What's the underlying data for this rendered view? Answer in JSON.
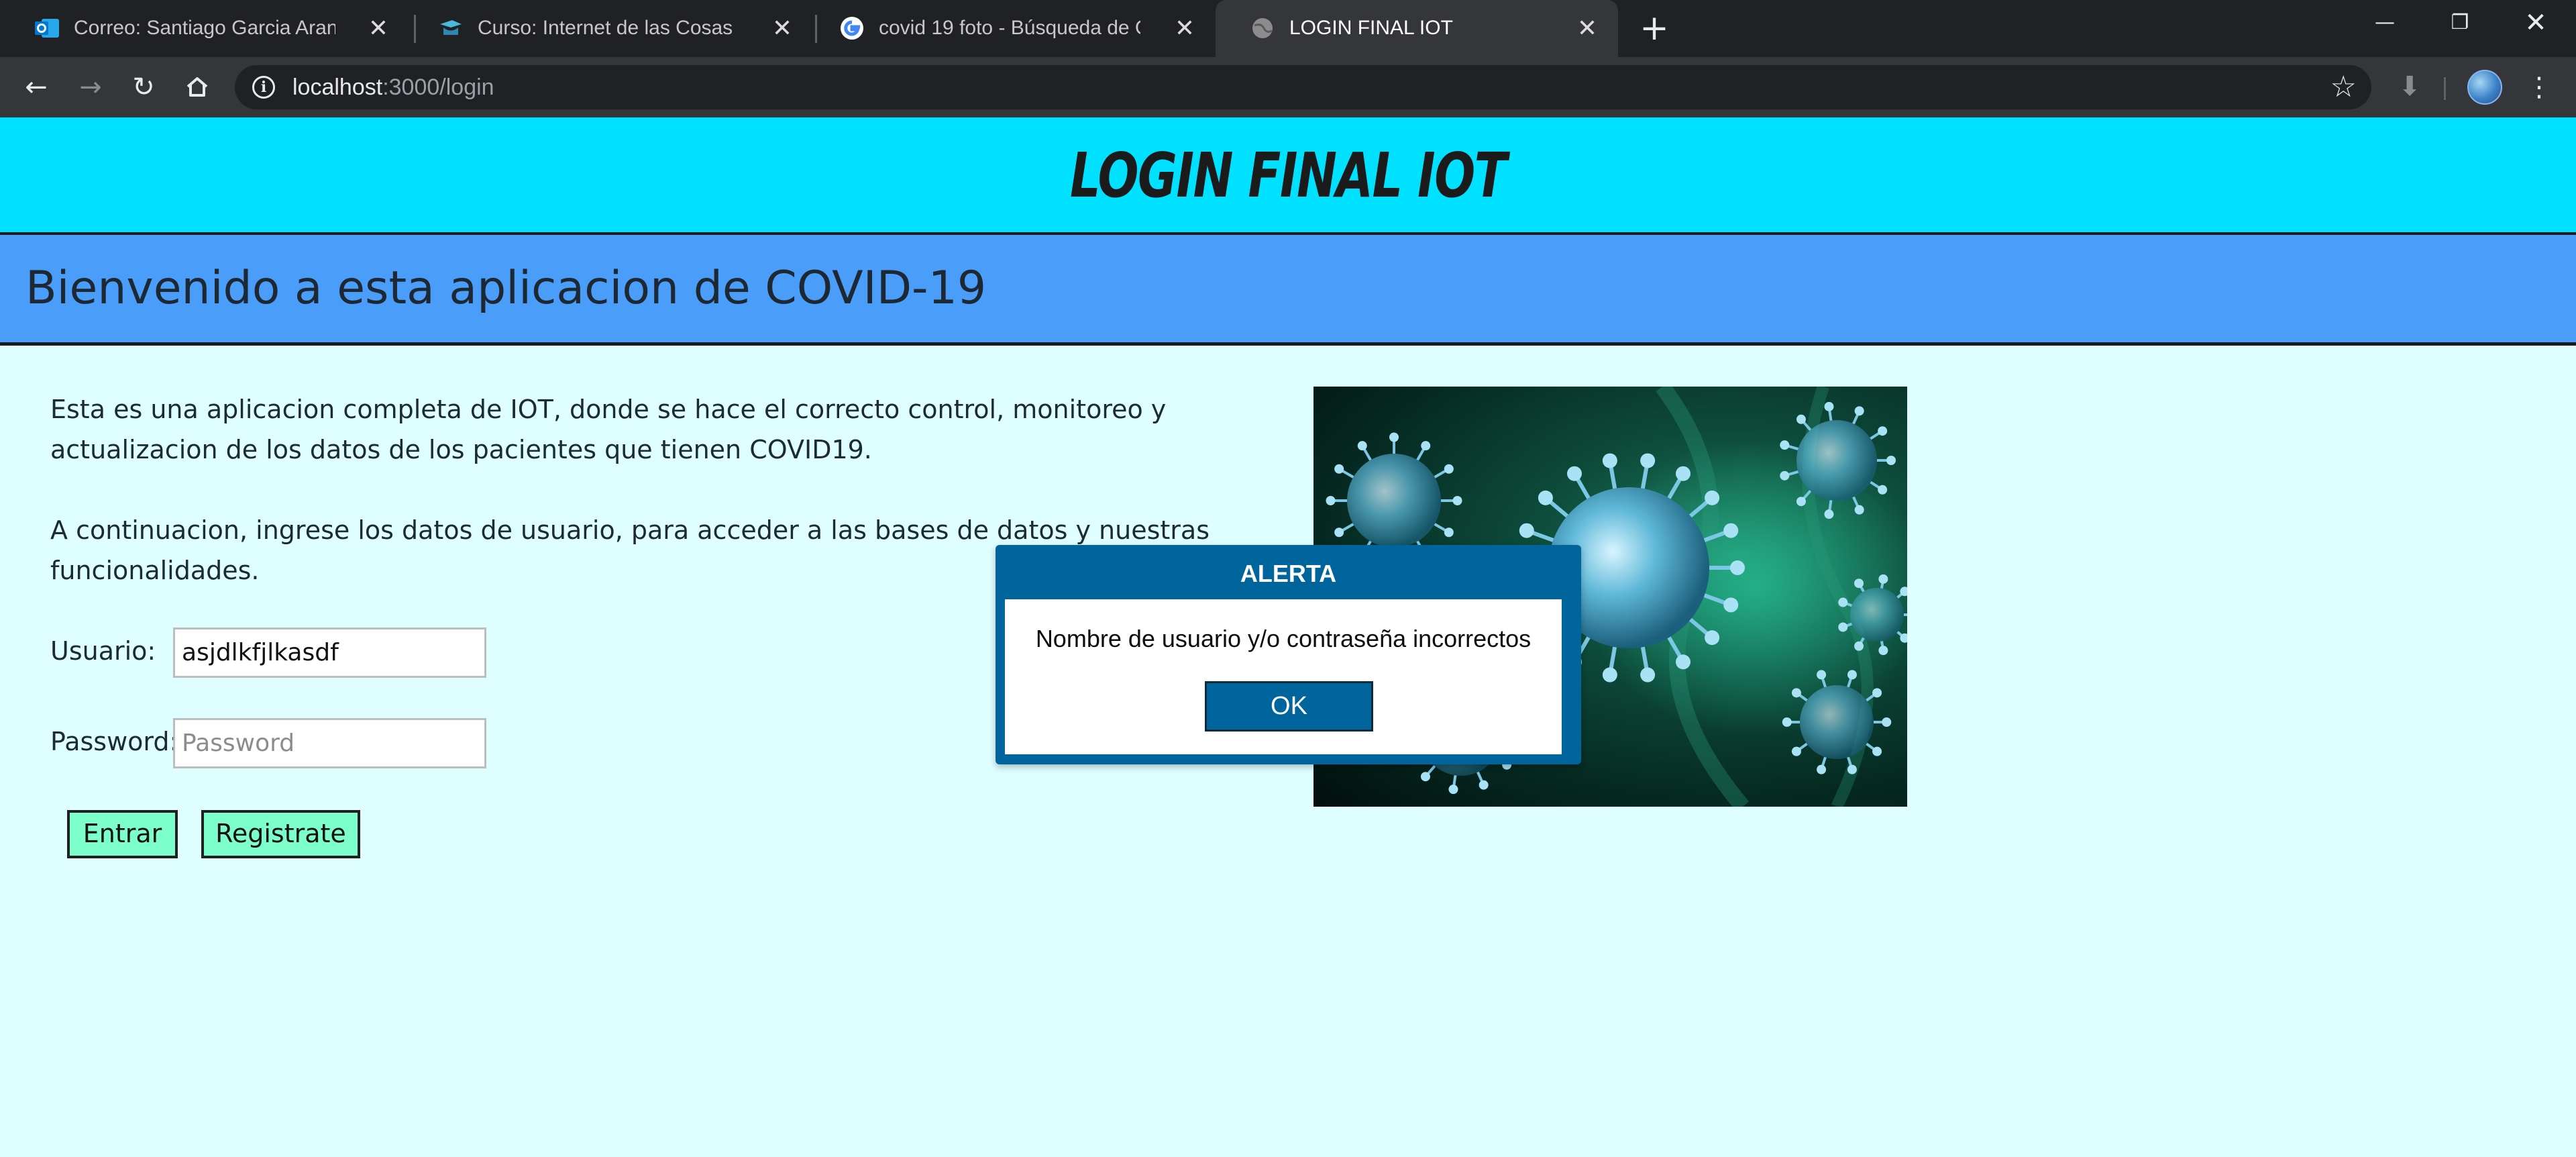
{
  "browser": {
    "tabs": [
      {
        "title": "Correo: Santiago Garcia Arango - ",
        "favicon": "outlook-icon",
        "active": false
      },
      {
        "title": "Curso: Internet de las Cosas",
        "favicon": "moodle-icon",
        "active": false
      },
      {
        "title": "covid 19 foto - Búsqueda de Goo",
        "favicon": "google-icon",
        "active": false
      },
      {
        "title": "LOGIN FINAL IOT",
        "favicon": "globe-icon",
        "active": true
      }
    ],
    "address": {
      "host": "localhost",
      "path": ":3000/login"
    },
    "colors": {
      "tabbar": "#202124",
      "toolbar": "#35363a",
      "omnibox": "#202124"
    }
  },
  "site": {
    "title": "LOGIN FINAL IOT",
    "welcome": "Bienvenido a esta aplicacion de COVID-19",
    "intro_1": "Esta es una aplicacion completa de IOT, donde se hace el correcto control, monitoreo y actualizacion de los datos de los pacientes que tienen COVID19.",
    "intro_2": "A continuacion, ingrese los datos de usuario, para acceder a las bases de datos y nuestras funcionalidades.",
    "colors": {
      "header": "#00e1ff",
      "welcome_bar": "#4a9df8",
      "background": "#dffeff",
      "buttons": "#7dffcc"
    }
  },
  "form": {
    "user_label": "Usuario:",
    "user_value": "asjdlkfjlkasdf",
    "password_label": "Password:",
    "password_placeholder": "Password",
    "submit_label": "Entrar",
    "register_label": "Registrate"
  },
  "alert": {
    "title": "ALERTA",
    "message": "Nombre de usuario y/o contraseña incorrectos",
    "ok_label": "OK",
    "color": "#00659c"
  }
}
